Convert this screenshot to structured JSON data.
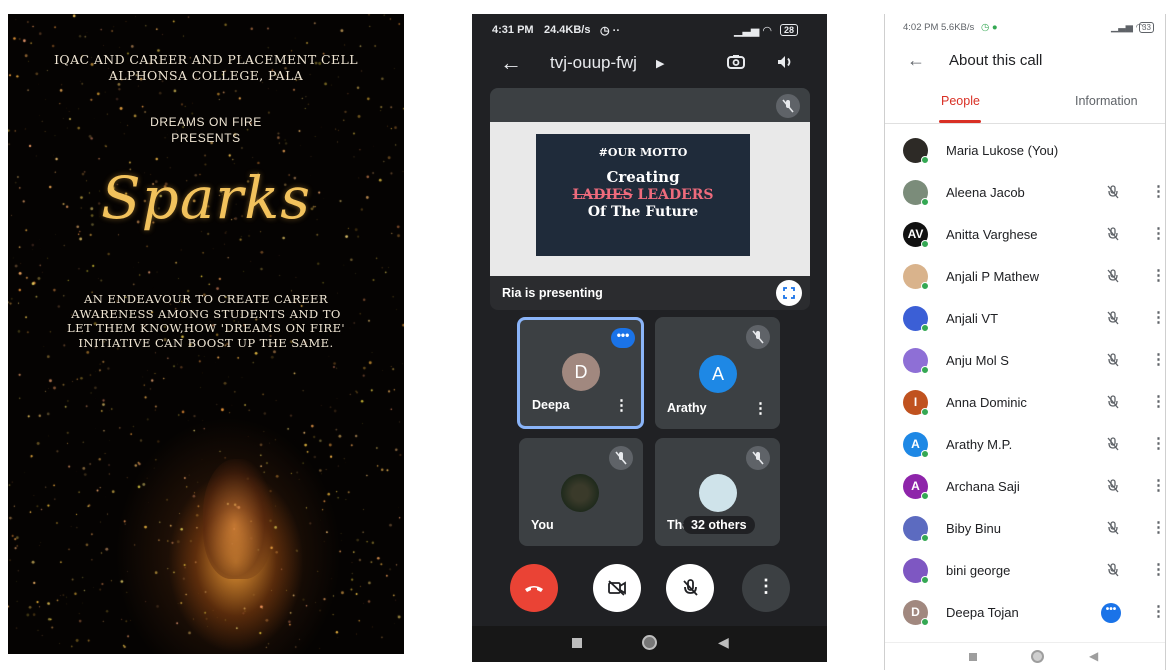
{
  "poster": {
    "line1": "IQAC AND CAREER AND PLACEMENT CELL",
    "line2": "ALPHONSA COLLEGE, PALA",
    "line3": "DREAMS ON FIRE",
    "line4": "PRESENTS",
    "title": "Sparks",
    "body": "AN ENDEAVOUR TO CREATE CAREER AWARENESS AMONG STUDENTS AND TO LET THEM KNOW,HOW 'DREAMS ON FIRE' INITIATIVE CAN BOOST UP THE SAME."
  },
  "meet": {
    "status_time": "4:31 PM",
    "status_speed": "24.4KB/s",
    "status_extra": "◷ ··",
    "status_battery": "28",
    "meeting_code": "tvj-ouup-fwj",
    "slide": {
      "heading": "#OUR MOTTO",
      "line1": "Creating",
      "strike_word": "LADIES",
      "line2_rest": " LEADERS",
      "line3": "Of The Future"
    },
    "presenting_label": "Ria is presenting",
    "tiles": [
      {
        "name": "Deepa",
        "initial": "D",
        "color": "#a1887f"
      },
      {
        "name": "Arathy",
        "initial": "A",
        "color": "#1e88e5"
      },
      {
        "name": "You"
      },
      {
        "name": "Tha",
        "others_label": "32 others"
      }
    ],
    "more_dots": "•••",
    "kebab": "⋮"
  },
  "about": {
    "status_time": "4:02 PM",
    "status_speed": "5.6KB/s",
    "status_battery": "33",
    "title": "About this call",
    "tab_people": "People",
    "tab_information": "Information",
    "participants": [
      {
        "name": "Maria Lukose (You)",
        "initial": "",
        "color": "#2d2a26"
      },
      {
        "name": "Aleena Jacob",
        "initial": "",
        "color": "#7b8c7a"
      },
      {
        "name": "Anitta Varghese",
        "initial": "AV",
        "color": "#111111"
      },
      {
        "name": "Anjali P Mathew",
        "initial": "",
        "color": "#d9b38c"
      },
      {
        "name": "Anjali VT",
        "initial": "",
        "color": "#3b5fd6"
      },
      {
        "name": "Anju Mol S",
        "initial": "",
        "color": "#8e6fd6"
      },
      {
        "name": "Anna Dominic",
        "initial": "I",
        "color": "#c0521f"
      },
      {
        "name": "Arathy M.P.",
        "initial": "A",
        "color": "#1e88e5"
      },
      {
        "name": "Archana Saji",
        "initial": "A",
        "color": "#8e24aa"
      },
      {
        "name": "Biby Binu",
        "initial": "",
        "color": "#5c6bc0"
      },
      {
        "name": "bini george",
        "initial": "",
        "color": "#7e57c2"
      },
      {
        "name": "Deepa Tojan",
        "initial": "D",
        "color": "#a1887f"
      }
    ],
    "more_dots": "•••",
    "kebab": "⋮"
  },
  "colors": {
    "end_call": "#ea4335",
    "meet_blue": "#1a73e8",
    "active_tab": "#d93025",
    "online": "#34a853"
  }
}
